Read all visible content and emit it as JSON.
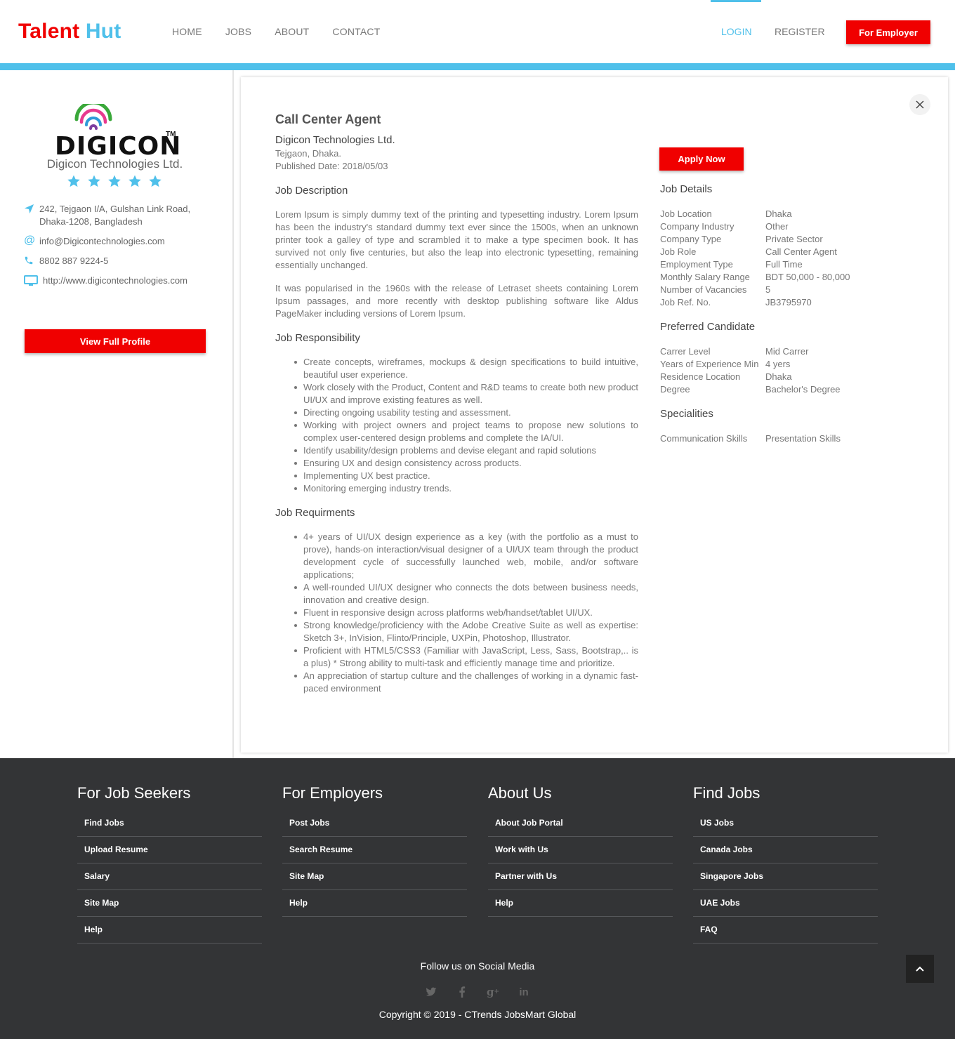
{
  "brand": {
    "part1": "Talent",
    "part2": "Hut"
  },
  "nav": [
    "HOME",
    "JOBS",
    "ABOUT",
    "CONTACT"
  ],
  "auth": {
    "login": "LOGIN",
    "register": "REGISTER",
    "employer": "For Employer"
  },
  "colors": {
    "accent_red": "#f00000",
    "accent_blue": "#4fc0ea",
    "footer_bg": "#333436"
  },
  "company": {
    "logo_text": "DIGICON",
    "logo_tm": "TM",
    "name": "Digicon Technologies Ltd.",
    "rating": 5,
    "address_line1": "242, Tejgaon I/A, Gulshan Link Road,",
    "address_line2": "Dhaka-1208, Bangladesh",
    "email": "info@Digicontechnologies.com",
    "phone": "8802 887 9224-5",
    "website": "http://www.digicontechnologies.com",
    "profile_button": "View Full Profile"
  },
  "job": {
    "title": "Call Center Agent",
    "company": "Digicon Technologies Ltd.",
    "location": "Tejgaon, Dhaka.",
    "published": "Published Date: 2018/05/03",
    "description_heading": "Job Description",
    "description_p1": "Lorem Ipsum is simply dummy text of the printing and typesetting industry. Lorem Ipsum has been the industry's standard dummy text ever since the 1500s, when an unknown printer took a galley of type and scrambled it to make a type specimen book. It has survived not only five centuries, but also the leap into electronic typesetting, remaining essentially unchanged.",
    "description_p2": "It was popularised in the 1960s with the release of Letraset sheets containing Lorem Ipsum passages, and more recently with desktop publishing software like Aldus PageMaker including versions of Lorem Ipsum.",
    "responsibility_heading": "Job Responsibility",
    "responsibilities": [
      "Create concepts, wireframes, mockups & design specifications to build intuitive, beautiful user experience.",
      "Work closely with the Product, Content and R&D teams to create both new product UI/UX and improve existing features as well.",
      "Directing ongoing usability testing and assessment.",
      "Working with project owners and project teams to propose new solutions to complex user-centered design problems and complete the IA/UI.",
      "Identify usability/design problems and devise elegant and rapid solutions",
      "Ensuring UX and design consistency across products.",
      "Implementing UX best practice.",
      "Monitoring emerging industry trends."
    ],
    "requirements_heading": "Job Requirments",
    "requirements": [
      "4+ years of UI/UX design experience as a key (with the portfolio as a must to prove), hands-on interaction/visual designer of a UI/UX team through the product development cycle of successfully launched web, mobile, and/or software applications;",
      "A well-rounded UI/UX designer who connects the dots between business needs, innovation and creative design.",
      "Fluent in responsive design across platforms web/handset/tablet UI/UX.",
      "Strong knowledge/proficiency with the Adobe Creative Suite as well as expertise: Sketch 3+, InVision, Flinto/Principle, UXPin, Photoshop, Illustrator.",
      "Proficient with HTML5/CSS3 (Familiar with JavaScript, Less, Sass, Bootstrap,.. is a plus) * Strong ability to multi-task and efficiently manage time and prioritize.",
      "An appreciation of startup culture and the challenges of working in a dynamic fast-paced environment"
    ],
    "apply_button": "Apply Now",
    "details_heading": "Job Details",
    "details": [
      [
        "Job Location",
        "Dhaka"
      ],
      [
        "Company Industry",
        "Other"
      ],
      [
        "Company Type",
        "Private Sector"
      ],
      [
        "Job Role",
        "Call Center Agent"
      ],
      [
        "Employment Type",
        "Full Time"
      ],
      [
        "Monthly Salary Range",
        "BDT 50,000 - 80,000"
      ],
      [
        "Number of Vacancies",
        "5"
      ],
      [
        "Job Ref. No.",
        "JB3795970"
      ]
    ],
    "preferred_heading": "Preferred Candidate",
    "preferred": [
      [
        "Carrer Level",
        "Mid Carrer"
      ],
      [
        "Years of Experience Min",
        "4 yers"
      ],
      [
        "Residence Location",
        "Dhaka"
      ],
      [
        "Degree",
        "Bachelor's Degree"
      ]
    ],
    "specialities_heading": "Specialities",
    "specialities": [
      "Communication Skills",
      "Presentation Skills"
    ]
  },
  "footer": {
    "columns": [
      {
        "title": "For Job Seekers",
        "links": [
          "Find Jobs",
          "Upload Resume",
          "Salary",
          "Site Map",
          "Help"
        ]
      },
      {
        "title": "For Employers",
        "links": [
          "Post Jobs",
          "Search Resume",
          "Site Map",
          "Help"
        ]
      },
      {
        "title": "About Us",
        "links": [
          "About Job Portal",
          "Work with Us",
          "Partner with Us",
          "Help"
        ]
      },
      {
        "title": "Find Jobs",
        "links": [
          "US Jobs",
          "Canada Jobs",
          "Singapore Jobs",
          "UAE Jobs",
          "FAQ"
        ]
      }
    ],
    "social_title": "Follow us on Social Media",
    "social_icons": [
      "twitter-icon",
      "facebook-icon",
      "google-plus-icon",
      "linkedin-icon"
    ],
    "copyright": "Copyright © 2019 - CTrends JobsMart Global"
  }
}
